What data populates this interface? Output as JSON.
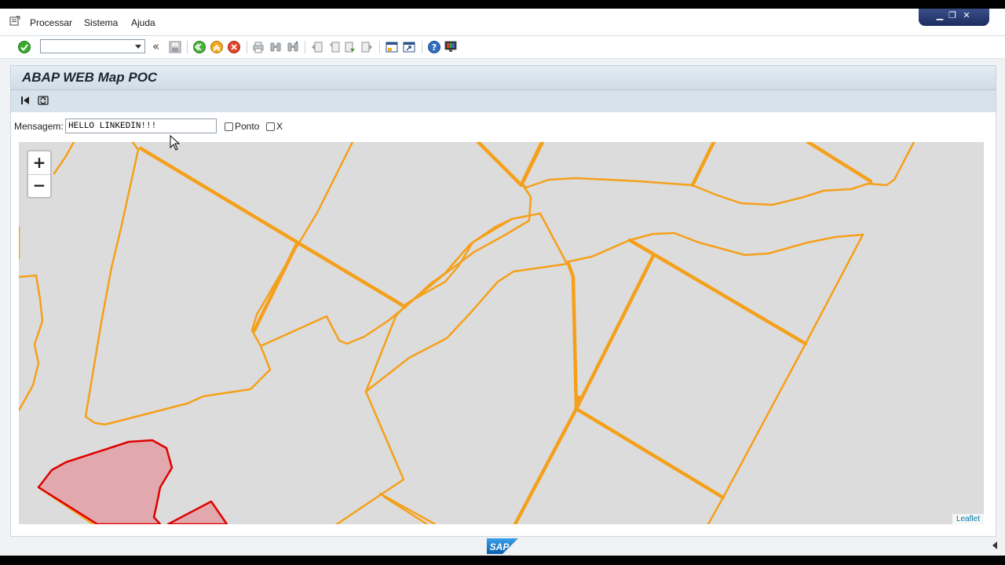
{
  "menu": {
    "items": [
      "Processar",
      "Sistema",
      "Ajuda"
    ]
  },
  "window_controls": [
    "minimize",
    "restore",
    "close"
  ],
  "toolbar": {
    "command_field_value": "",
    "icons": [
      "enter-icon",
      "save-icon",
      "back-icon",
      "exit-icon",
      "cancel-icon",
      "print-icon",
      "find-icon",
      "find-next-icon",
      "first-page-icon",
      "previous-page-icon",
      "next-page-icon",
      "last-page-icon",
      "new-session-icon",
      "shortcut-icon",
      "help-icon",
      "layout-icon"
    ]
  },
  "page": {
    "title": "ABAP WEB Map POC"
  },
  "form": {
    "message_label": "Mensagem:",
    "message_value": "HELLO LINKEDIN!!!",
    "ponto_label": "Ponto",
    "ponto_checked": false,
    "x_label": "X",
    "x_checked": false
  },
  "map": {
    "zoom_in_label": "+",
    "zoom_out_label": "−",
    "attribution": "Leaflet",
    "background_color": "#dcdcdc",
    "parcel_stroke_color": "#f5a01a",
    "selected_stroke_color": "#e00000",
    "selected_fill_color": "#e2a0a4"
  },
  "statusbar": {
    "logo_text": "SAP"
  },
  "colors": {
    "menu_bg": "#ffffff",
    "title_bar": "#dce6ee",
    "accent": "#1c2d5e"
  }
}
